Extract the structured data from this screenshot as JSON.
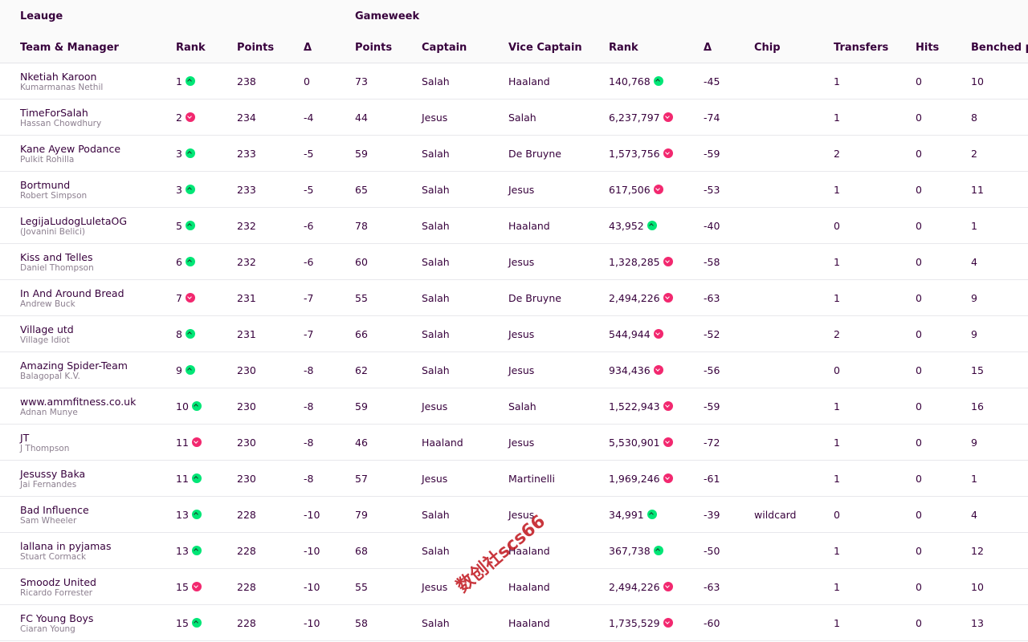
{
  "groups": {
    "league": "Leauge",
    "gameweek": "Gameweek"
  },
  "columns": {
    "team": "Team & Manager",
    "rank": "Rank",
    "points": "Points",
    "delta": "Δ",
    "gw_points": "Points",
    "captain": "Captain",
    "vice_captain": "Vice Captain",
    "gw_rank": "Rank",
    "gw_delta": "Δ",
    "chip": "Chip",
    "transfers": "Transfers",
    "hits": "Hits",
    "benched": "Benched p"
  },
  "colors": {
    "up": "#00e676",
    "down": "#f2286f",
    "text": "#37003c"
  },
  "rows": [
    {
      "team": "Nketiah Karoon",
      "manager": "Kumarmanas Nethil",
      "rank": "1",
      "rank_dir": "up",
      "points": "238",
      "delta": "0",
      "gw_points": "73",
      "captain": "Salah",
      "vice": "Haaland",
      "gw_rank": "140,768",
      "gw_rank_dir": "up",
      "gw_delta": "-45",
      "chip": "",
      "transfers": "1",
      "hits": "0",
      "benched": "10"
    },
    {
      "team": "TimeForSalah",
      "manager": "Hassan Chowdhury",
      "rank": "2",
      "rank_dir": "down",
      "points": "234",
      "delta": "-4",
      "gw_points": "44",
      "captain": "Jesus",
      "vice": "Salah",
      "gw_rank": "6,237,797",
      "gw_rank_dir": "down",
      "gw_delta": "-74",
      "chip": "",
      "transfers": "1",
      "hits": "0",
      "benched": "8"
    },
    {
      "team": "Kane Ayew Podance",
      "manager": "Pulkit Rohilla",
      "rank": "3",
      "rank_dir": "up",
      "points": "233",
      "delta": "-5",
      "gw_points": "59",
      "captain": "Salah",
      "vice": "De Bruyne",
      "gw_rank": "1,573,756",
      "gw_rank_dir": "down",
      "gw_delta": "-59",
      "chip": "",
      "transfers": "2",
      "hits": "0",
      "benched": "2"
    },
    {
      "team": "Bortmund",
      "manager": "Robert Simpson",
      "rank": "3",
      "rank_dir": "up",
      "points": "233",
      "delta": "-5",
      "gw_points": "65",
      "captain": "Salah",
      "vice": "Jesus",
      "gw_rank": "617,506",
      "gw_rank_dir": "down",
      "gw_delta": "-53",
      "chip": "",
      "transfers": "1",
      "hits": "0",
      "benched": "11"
    },
    {
      "team": "LegijaLudogLuletaOG",
      "manager": "(Jovanini Belici)",
      "rank": "5",
      "rank_dir": "up",
      "points": "232",
      "delta": "-6",
      "gw_points": "78",
      "captain": "Salah",
      "vice": "Haaland",
      "gw_rank": "43,952",
      "gw_rank_dir": "up",
      "gw_delta": "-40",
      "chip": "",
      "transfers": "0",
      "hits": "0",
      "benched": "1"
    },
    {
      "team": "Kiss and Telles",
      "manager": "Daniel Thompson",
      "rank": "6",
      "rank_dir": "up",
      "points": "232",
      "delta": "-6",
      "gw_points": "60",
      "captain": "Salah",
      "vice": "Jesus",
      "gw_rank": "1,328,285",
      "gw_rank_dir": "down",
      "gw_delta": "-58",
      "chip": "",
      "transfers": "1",
      "hits": "0",
      "benched": "4"
    },
    {
      "team": "In And Around Bread",
      "manager": "Andrew Buck",
      "rank": "7",
      "rank_dir": "down",
      "points": "231",
      "delta": "-7",
      "gw_points": "55",
      "captain": "Salah",
      "vice": "De Bruyne",
      "gw_rank": "2,494,226",
      "gw_rank_dir": "down",
      "gw_delta": "-63",
      "chip": "",
      "transfers": "1",
      "hits": "0",
      "benched": "9"
    },
    {
      "team": "Village utd",
      "manager": "Village Idiot",
      "rank": "8",
      "rank_dir": "up",
      "points": "231",
      "delta": "-7",
      "gw_points": "66",
      "captain": "Salah",
      "vice": "Jesus",
      "gw_rank": "544,944",
      "gw_rank_dir": "down",
      "gw_delta": "-52",
      "chip": "",
      "transfers": "2",
      "hits": "0",
      "benched": "9"
    },
    {
      "team": "Amazing Spider-Team",
      "manager": "Balagopal K.V.",
      "rank": "9",
      "rank_dir": "up",
      "points": "230",
      "delta": "-8",
      "gw_points": "62",
      "captain": "Salah",
      "vice": "Jesus",
      "gw_rank": "934,436",
      "gw_rank_dir": "down",
      "gw_delta": "-56",
      "chip": "",
      "transfers": "0",
      "hits": "0",
      "benched": "15"
    },
    {
      "team": "www.ammfitness.co.uk",
      "manager": "Adnan Munye",
      "rank": "10",
      "rank_dir": "up",
      "points": "230",
      "delta": "-8",
      "gw_points": "59",
      "captain": "Jesus",
      "vice": "Salah",
      "gw_rank": "1,522,943",
      "gw_rank_dir": "down",
      "gw_delta": "-59",
      "chip": "",
      "transfers": "1",
      "hits": "0",
      "benched": "16"
    },
    {
      "team": "JT",
      "manager": "J Thompson",
      "rank": "11",
      "rank_dir": "down",
      "points": "230",
      "delta": "-8",
      "gw_points": "46",
      "captain": "Haaland",
      "vice": "Jesus",
      "gw_rank": "5,530,901",
      "gw_rank_dir": "down",
      "gw_delta": "-72",
      "chip": "",
      "transfers": "1",
      "hits": "0",
      "benched": "9"
    },
    {
      "team": "Jesussy Baka",
      "manager": "Jai Fernandes",
      "rank": "11",
      "rank_dir": "up",
      "points": "230",
      "delta": "-8",
      "gw_points": "57",
      "captain": "Jesus",
      "vice": "Martinelli",
      "gw_rank": "1,969,246",
      "gw_rank_dir": "down",
      "gw_delta": "-61",
      "chip": "",
      "transfers": "1",
      "hits": "0",
      "benched": "1"
    },
    {
      "team": "Bad Influence",
      "manager": "Sam Wheeler",
      "rank": "13",
      "rank_dir": "up",
      "points": "228",
      "delta": "-10",
      "gw_points": "79",
      "captain": "Salah",
      "vice": "Jesus",
      "gw_rank": "34,991",
      "gw_rank_dir": "up",
      "gw_delta": "-39",
      "chip": "wildcard",
      "transfers": "0",
      "hits": "0",
      "benched": "4"
    },
    {
      "team": "lallana in pyjamas",
      "manager": "Stuart Cormack",
      "rank": "13",
      "rank_dir": "up",
      "points": "228",
      "delta": "-10",
      "gw_points": "68",
      "captain": "Salah",
      "vice": "Haaland",
      "gw_rank": "367,738",
      "gw_rank_dir": "up",
      "gw_delta": "-50",
      "chip": "",
      "transfers": "1",
      "hits": "0",
      "benched": "12"
    },
    {
      "team": "Smoodz United",
      "manager": "Ricardo Forrester",
      "rank": "15",
      "rank_dir": "down",
      "points": "228",
      "delta": "-10",
      "gw_points": "55",
      "captain": "Jesus",
      "vice": "Haaland",
      "gw_rank": "2,494,226",
      "gw_rank_dir": "down",
      "gw_delta": "-63",
      "chip": "",
      "transfers": "1",
      "hits": "0",
      "benched": "10"
    },
    {
      "team": "FC Young Boys",
      "manager": "Ciaran Young",
      "rank": "15",
      "rank_dir": "up",
      "points": "228",
      "delta": "-10",
      "gw_points": "58",
      "captain": "Salah",
      "vice": "Haaland",
      "gw_rank": "1,735,529",
      "gw_rank_dir": "down",
      "gw_delta": "-60",
      "chip": "",
      "transfers": "1",
      "hits": "0",
      "benched": "13"
    }
  ],
  "watermark": "数创社scs66"
}
